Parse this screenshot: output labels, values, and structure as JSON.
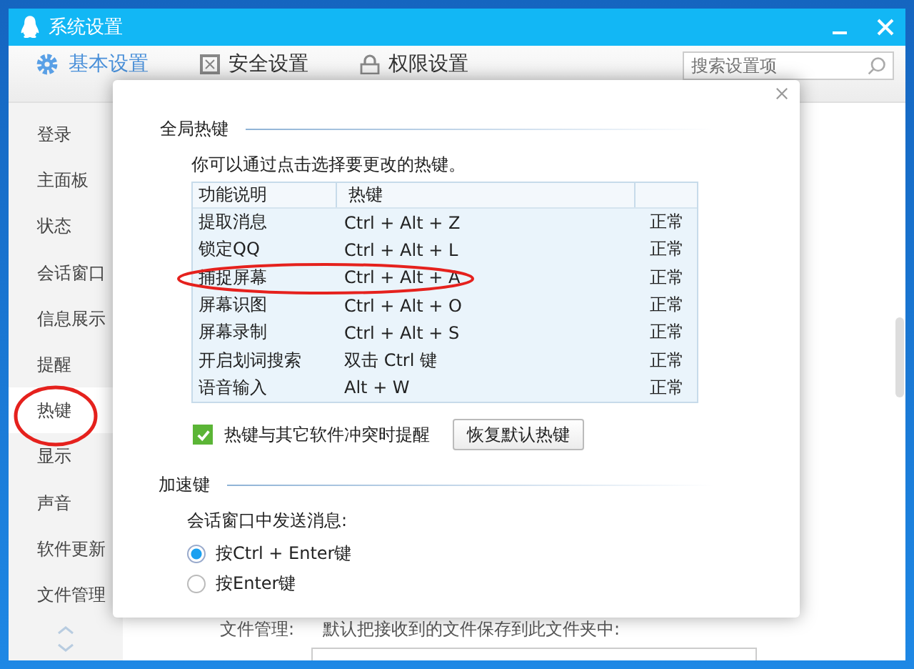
{
  "window": {
    "title": "系统设置"
  },
  "tabs": [
    {
      "label": "基本设置",
      "selected": true
    },
    {
      "label": "安全设置",
      "selected": false
    },
    {
      "label": "权限设置",
      "selected": false
    }
  ],
  "search": {
    "placeholder": "搜索设置项"
  },
  "sidebar": {
    "items": [
      {
        "label": "登录",
        "selected": false,
        "circled": false
      },
      {
        "label": "主面板",
        "selected": false,
        "circled": false
      },
      {
        "label": "状态",
        "selected": false,
        "circled": false
      },
      {
        "label": "会话窗口",
        "selected": false,
        "circled": false
      },
      {
        "label": "信息展示",
        "selected": false,
        "circled": false
      },
      {
        "label": "提醒",
        "selected": false,
        "circled": false
      },
      {
        "label": "热键",
        "selected": true,
        "circled": true
      },
      {
        "label": "显示",
        "selected": false,
        "circled": false
      },
      {
        "label": "声音",
        "selected": false,
        "circled": false
      },
      {
        "label": "软件更新",
        "selected": false,
        "circled": false
      },
      {
        "label": "文件管理",
        "selected": false,
        "circled": false
      }
    ]
  },
  "file_management": {
    "label": "文件管理:",
    "description": "默认把接收到的文件保存到此文件夹中:"
  },
  "dialog": {
    "hotkeys": {
      "title": "全局热键",
      "hint": "你可以通过点击选择要更改的热键。",
      "columns": [
        "功能说明",
        "热键"
      ],
      "rows": [
        {
          "function": "提取消息",
          "hotkey": "Ctrl + Alt + Z",
          "status": "正常",
          "circled": false
        },
        {
          "function": "锁定QQ",
          "hotkey": "Ctrl + Alt + L",
          "status": "正常",
          "circled": false
        },
        {
          "function": "捕捉屏幕",
          "hotkey": "Ctrl + Alt + A",
          "status": "正常",
          "circled": true
        },
        {
          "function": "屏幕识图",
          "hotkey": "Ctrl + Alt + O",
          "status": "正常",
          "circled": false
        },
        {
          "function": "屏幕录制",
          "hotkey": "Ctrl + Alt + S",
          "status": "正常",
          "circled": false
        },
        {
          "function": "开启划词搜索",
          "hotkey": "双击 Ctrl 键",
          "status": "正常",
          "circled": false
        },
        {
          "function": "语音输入",
          "hotkey": "Alt + W",
          "status": "正常",
          "circled": false
        }
      ]
    },
    "conflict_alert": {
      "label": "热键与其它软件冲突时提醒",
      "checked": true
    },
    "restore_button": "恢复默认热键",
    "accelerator": {
      "title": "加速键",
      "prompt": "会话窗口中发送消息:",
      "options": [
        {
          "label": "按Ctrl + Enter键",
          "selected": true
        },
        {
          "label": "按Enter键",
          "selected": false
        }
      ]
    }
  }
}
